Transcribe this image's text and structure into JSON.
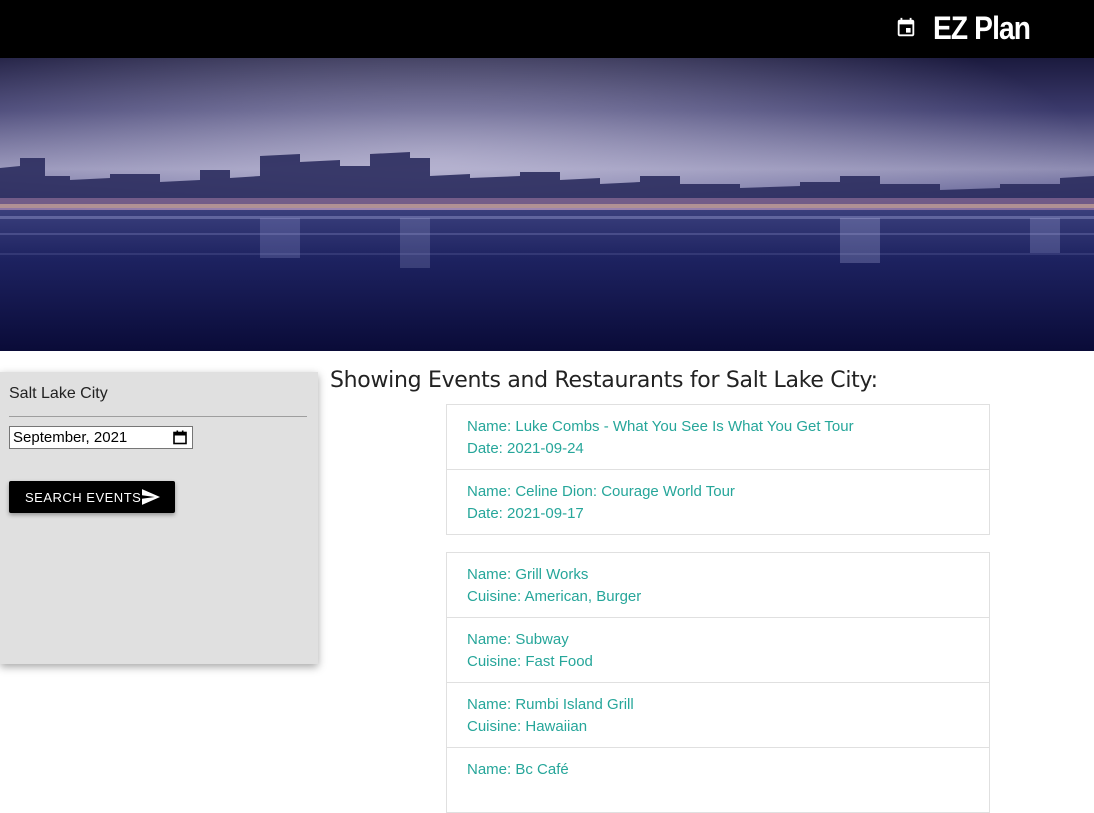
{
  "navbar": {
    "brand": "EZ Plan",
    "brand_icon": "calendar-event-icon"
  },
  "hero": {
    "image": "city-skyline-night-waterfront"
  },
  "sidebar": {
    "city_value": "Salt Lake City",
    "date_value": "September, 2021",
    "date_icon": "calendar-icon",
    "search_button": "SEARCH EVENTS",
    "search_button_icon": "send-icon"
  },
  "results": {
    "heading": "Showing Events and Restaurants for Salt Lake City:",
    "events": [
      {
        "name": "Name: Luke Combs - What You See Is What You Get Tour",
        "detail": "Date: 2021-09-24"
      },
      {
        "name": "Name: Celine Dion: Courage World Tour",
        "detail": "Date: 2021-09-17"
      }
    ],
    "restaurants": [
      {
        "name": "Name: Grill Works",
        "detail": "Cuisine: American, Burger"
      },
      {
        "name": "Name: Subway",
        "detail": "Cuisine: Fast Food"
      },
      {
        "name": "Name: Rumbi Island Grill",
        "detail": "Cuisine: Hawaiian"
      },
      {
        "name": "Name: Bc Café",
        "detail": ""
      }
    ]
  },
  "colors": {
    "navbar_bg": "#000000",
    "sidebar_bg": "#e0e0e0",
    "link_teal": "#26a69a",
    "button_bg": "#000000"
  }
}
